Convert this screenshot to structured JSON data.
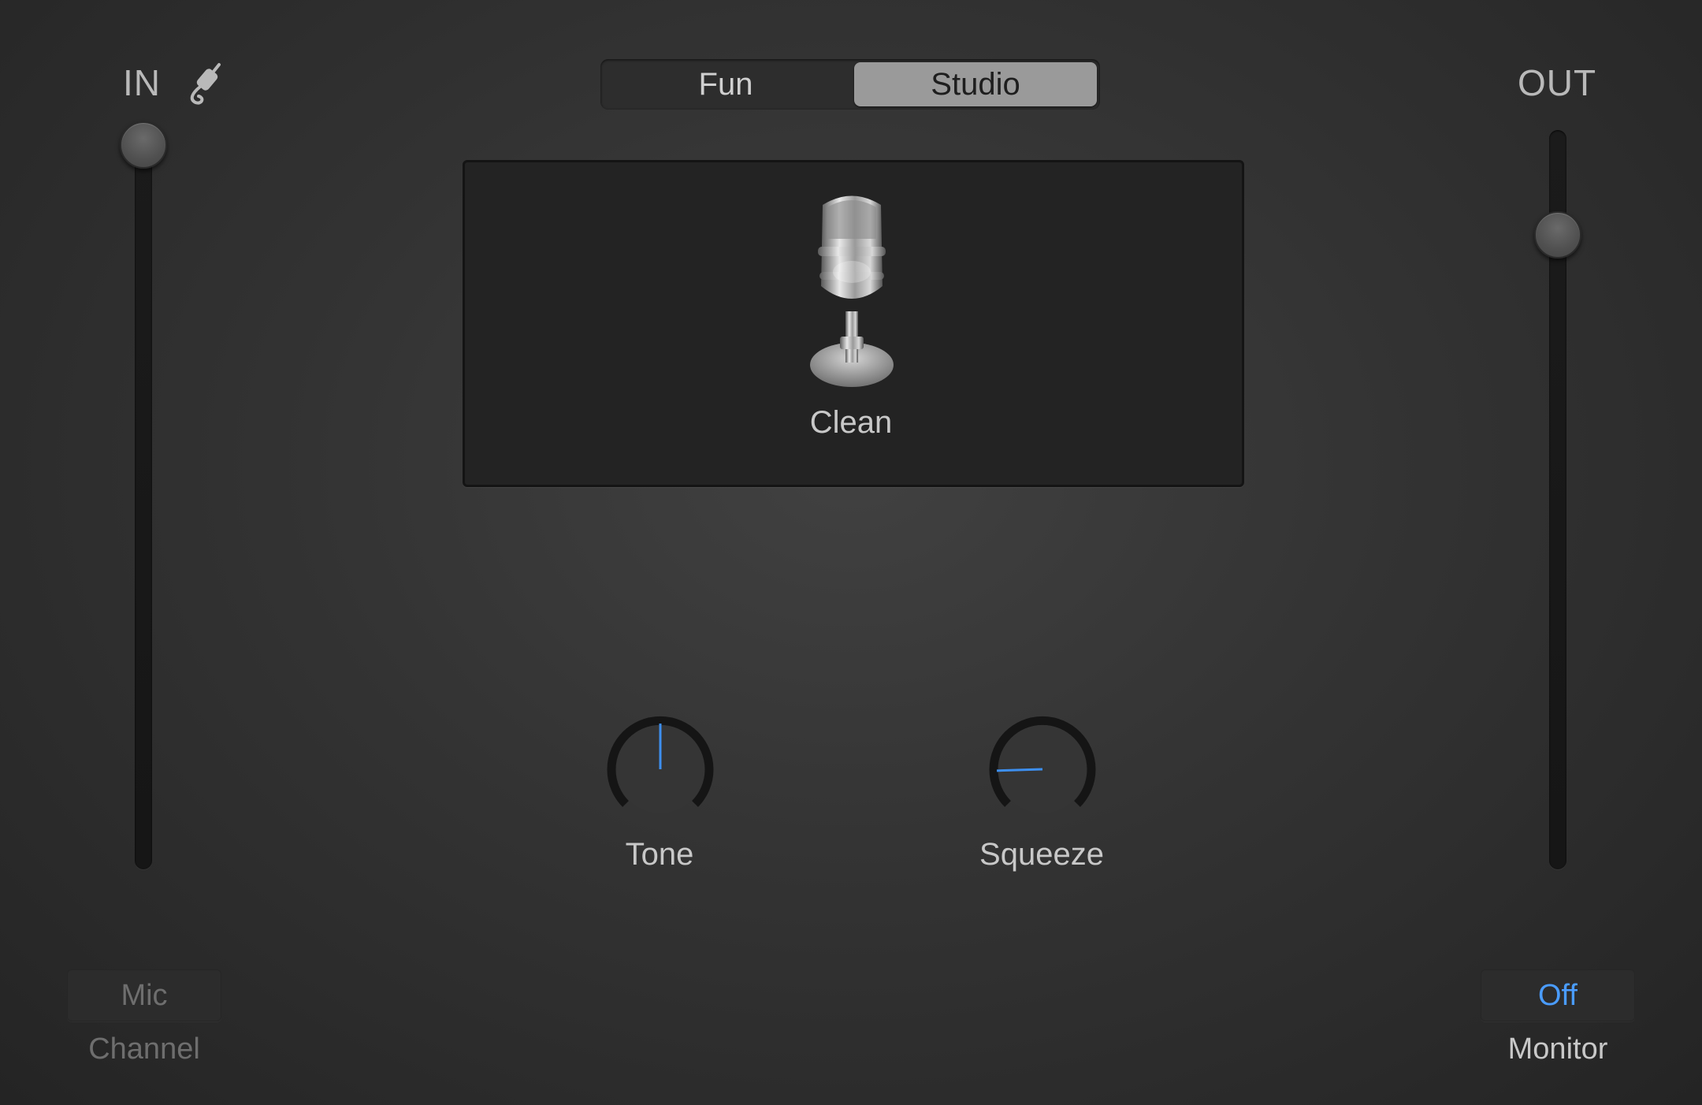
{
  "input": {
    "label": "IN",
    "icon": "input-cable-icon",
    "level": 1.0
  },
  "output": {
    "label": "OUT",
    "level": 0.87
  },
  "mode_selector": {
    "options": [
      "Fun",
      "Studio"
    ],
    "selected": "Studio"
  },
  "preset": {
    "icon": "microphone-icon",
    "name": "Clean"
  },
  "knobs": {
    "tone": {
      "label": "Tone",
      "value": 0.5
    },
    "squeeze": {
      "label": "Squeeze",
      "value": 0.16
    }
  },
  "channel": {
    "button_label": "Mic",
    "caption": "Channel"
  },
  "monitor": {
    "button_label": "Off",
    "caption": "Monitor"
  },
  "colors": {
    "accent": "#4a9cff",
    "background": "#333333",
    "selected_segment": "#9a9a9a"
  }
}
